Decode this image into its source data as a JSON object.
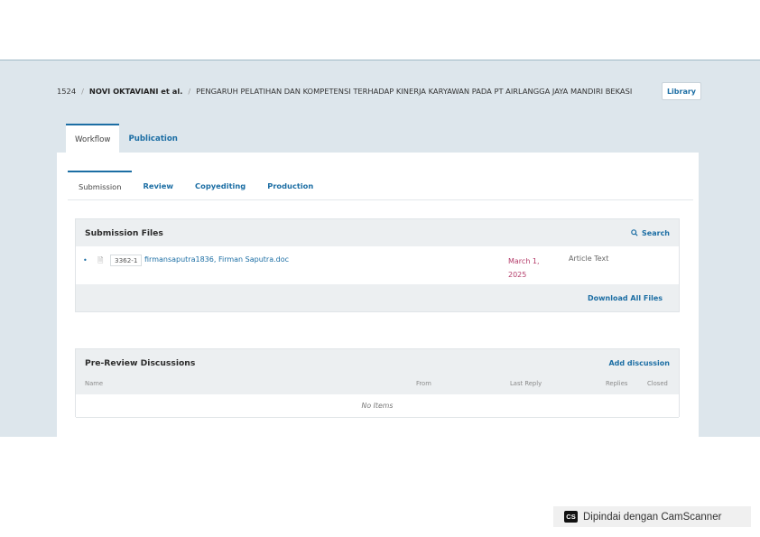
{
  "header": {
    "id": "1524",
    "author": "NOVI OKTAVIANI et al.",
    "title": "PENGARUH PELATIHAN DAN KOMPETENSI TERHADAP KINERJA KARYAWAN PADA PT AIRLANGGA JAYA MANDIRI BEKASI",
    "library_label": "Library"
  },
  "main_tabs": [
    {
      "label": "Workflow",
      "active": true
    },
    {
      "label": "Publication",
      "active": false
    }
  ],
  "stage_tabs": [
    {
      "label": "Submission",
      "active": true
    },
    {
      "label": "Review",
      "active": false
    },
    {
      "label": "Copyediting",
      "active": false
    },
    {
      "label": "Production",
      "active": false
    }
  ],
  "submission_files": {
    "title": "Submission Files",
    "search_label": "Search",
    "files": [
      {
        "id": "3362-1",
        "name": "firmansaputra1836, Firman Saputra.doc",
        "date": "March 1, 2025",
        "type": "Article Text"
      }
    ],
    "download_all_label": "Download All Files"
  },
  "discussions": {
    "title": "Pre-Review Discussions",
    "add_label": "Add discussion",
    "columns": {
      "name": "Name",
      "from": "From",
      "last_reply": "Last Reply",
      "replies": "Replies",
      "closed": "Closed"
    },
    "empty_label": "No Items"
  },
  "watermark": {
    "logo": "CS",
    "text": "Dipindai dengan CamScanner"
  },
  "colors": {
    "accent": "#1c6ea4",
    "date": "#b43c6a",
    "background": "#dde6ec"
  }
}
